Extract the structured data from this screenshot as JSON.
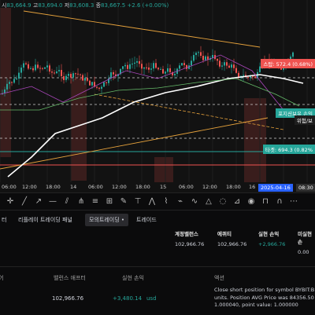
{
  "ohlc": {
    "open_label": "시",
    "open": "83,664.9",
    "high_label": "고",
    "high": "83,694.0",
    "low_label": "저",
    "low": "83,608.3",
    "close_label": "종",
    "close": "83,667.5",
    "change": "+2.6 (+0.00%)"
  },
  "price_tags": {
    "stop_loss": "스탑: 572.4 (0.68%)",
    "position": "포지션보유 손익",
    "position_sub": "위험/보",
    "target": "타겟: 694.3 (0.82%"
  },
  "time_axis": {
    "labels": [
      "06:00",
      "12:00",
      "18:00",
      "14",
      "06:00",
      "12:00",
      "18:00",
      "15",
      "06:00",
      "12:00",
      "18:00",
      "16"
    ],
    "cursor_time": "2025-04-16",
    "cursor_clock": "08:30"
  },
  "colors": {
    "chart_bg": "#121212",
    "up": "#26a69a",
    "down": "#ef5350",
    "accent": "#2962ff",
    "stop": "#ef5350",
    "target": "#26a69a"
  },
  "toolbar": {
    "icons": [
      "crosshair-icon",
      "trendline-icon",
      "ray-icon",
      "horizontal-line-icon",
      "channel-icon",
      "pitchfork-icon",
      "fib-icon",
      "gann-icon",
      "brush-icon",
      "text-icon",
      "pattern-icon",
      "path-icon",
      "zigzag-icon",
      "wave-icon",
      "triangle-icon",
      "circle-icon",
      "measure-icon",
      "eye-icon",
      "lock-icon",
      "magnet-icon",
      "more-icon"
    ]
  },
  "tabs": {
    "partial": "터",
    "replay_panel": "리플레이 트레이딩 패널",
    "demo_trading": "모의트레이딩 •",
    "trade": "트레이드"
  },
  "summary": {
    "account_balance_label": "계정밸런스",
    "account_balance": "102,966.76",
    "equity_label": "에퀴티",
    "equity": "102,966.76",
    "realized_pl_label": "실현 손익",
    "realized_pl": "+2,966.76",
    "unrealized_pl_label": "미실현 손",
    "unrealized_pl": "0.00"
  },
  "log": {
    "h_partial": "어",
    "h_balance_after": "밸런스 애프터",
    "h_realized": "실현 손익",
    "h_action": "액션",
    "balance_after": "102,966.76",
    "realized": "+3,480.14",
    "realized_unit": "usd",
    "message_line1": "Close short position for symbol BYBIT:B",
    "message_line2": "units. Position AVG Price was 84356.50",
    "message_line3": "1.000040, point value: 1.000000"
  }
}
